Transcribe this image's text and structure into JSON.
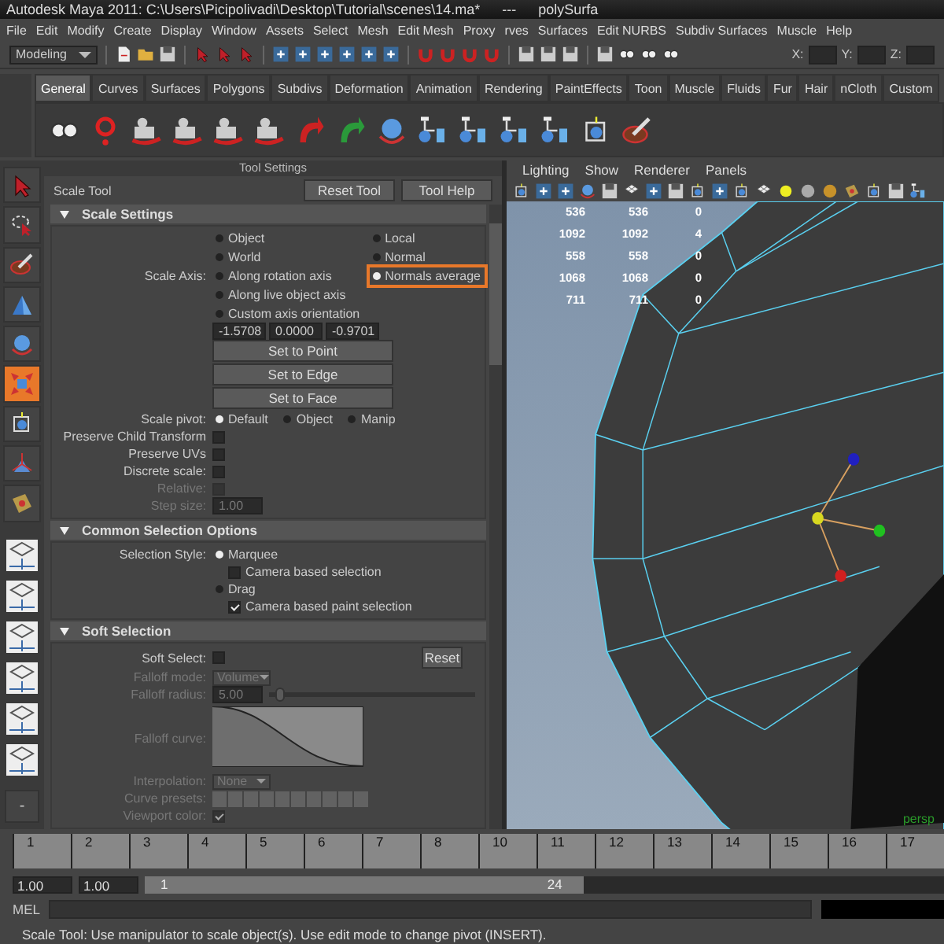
{
  "window": {
    "title": "Autodesk Maya 2011: C:\\Users\\Picipolivadi\\Desktop\\Tutorial\\scenes\\14.ma*",
    "subtitle": "---",
    "object": "polySurfa"
  },
  "menu_bar": [
    "File",
    "Edit",
    "Modify",
    "Create",
    "Display",
    "Window",
    "Assets",
    "Select",
    "Mesh",
    "Edit Mesh",
    "Proxy",
    "rves",
    "Surfaces",
    "Edit NURBS",
    "Subdiv Surfaces",
    "Muscle",
    "Help"
  ],
  "status_line": {
    "mode": "Modeling",
    "coords": [
      "X:",
      "Y:",
      "Z:"
    ]
  },
  "shelf": {
    "tabs": [
      {
        "label": "General",
        "selected": true
      },
      {
        "label": "Curves",
        "selected": false
      },
      {
        "label": "Surfaces",
        "selected": false
      },
      {
        "label": "Polygons",
        "selected": false
      },
      {
        "label": "Subdivs",
        "selected": false
      },
      {
        "label": "Deformation",
        "selected": false
      },
      {
        "label": "Animation",
        "selected": false
      },
      {
        "label": "Rendering",
        "selected": false
      },
      {
        "label": "PaintEffects",
        "selected": false
      },
      {
        "label": "Toon",
        "selected": false
      },
      {
        "label": "Muscle",
        "selected": false
      },
      {
        "label": "Fluids",
        "selected": false
      },
      {
        "label": "Fur",
        "selected": false
      },
      {
        "label": "Hair",
        "selected": false
      },
      {
        "label": "nCloth",
        "selected": false
      },
      {
        "label": "Custom",
        "selected": false
      }
    ]
  },
  "toolbox": {
    "tools": [
      {
        "selected": false
      },
      {
        "selected": false
      },
      {
        "selected": false
      },
      {
        "selected": false
      },
      {
        "selected": false
      },
      {
        "selected": true
      },
      {
        "selected": false
      },
      {
        "selected": false
      },
      {
        "selected": false
      }
    ],
    "collapse_label": "-"
  },
  "tool_settings": {
    "title": "Tool Settings",
    "tool_name": "Scale Tool",
    "buttons": [
      "Reset Tool",
      "Tool Help"
    ],
    "sections": [
      {
        "title": "Scale Settings",
        "expanded": true,
        "rows": [
          {
            "kind": "radio_columns",
            "label": "Scale Axis:",
            "columns": [
              [
                {
                  "label": "Object",
                  "selected": false,
                  "highlighted": false
                },
                {
                  "label": "World",
                  "selected": false,
                  "highlighted": false
                },
                {
                  "label": "Along rotation axis",
                  "selected": false,
                  "highlighted": false
                },
                {
                  "label": "Along live object axis",
                  "selected": false,
                  "highlighted": false
                },
                {
                  "label": "Custom axis orientation",
                  "selected": false,
                  "highlighted": false
                }
              ],
              [
                {
                  "label": "Local",
                  "selected": false,
                  "highlighted": false
                },
                {
                  "label": "Normal",
                  "selected": false,
                  "highlighted": false
                },
                {
                  "label": "Normals average",
                  "selected": true,
                  "highlighted": true
                }
              ]
            ]
          },
          {
            "kind": "fields",
            "values": [
              "-1.5708",
              "0.0000",
              "-0.9701"
            ]
          },
          {
            "kind": "button",
            "label": "Set to Point"
          },
          {
            "kind": "button",
            "label": "Set to Edge"
          },
          {
            "kind": "button",
            "label": "Set to Face"
          },
          {
            "kind": "radio_row",
            "label": "Scale pivot:",
            "options": [
              {
                "label": "Default",
                "selected": true
              },
              {
                "label": "Object",
                "selected": false
              },
              {
                "label": "Manip",
                "selected": false
              }
            ]
          },
          {
            "kind": "check",
            "label": "Preserve Child Transform",
            "checked": false,
            "disabled": false
          },
          {
            "kind": "check",
            "label": "Preserve UVs",
            "checked": false,
            "disabled": false
          },
          {
            "kind": "check",
            "label": "Discrete scale:",
            "checked": false,
            "disabled": false
          },
          {
            "kind": "check",
            "label": "Relative:",
            "checked": false,
            "disabled": true
          },
          {
            "kind": "field",
            "label": "Step size:",
            "value": "1.00",
            "disabled": true
          }
        ]
      },
      {
        "title": "Common Selection Options",
        "expanded": true,
        "rows": [
          {
            "kind": "radio",
            "label": "Selection Style:",
            "option": "Marquee",
            "selected": true
          },
          {
            "kind": "sub_check",
            "label": "Camera based selection",
            "checked": false
          },
          {
            "kind": "radio",
            "option": "Drag",
            "selected": false
          },
          {
            "kind": "sub_check",
            "label": "Camera based paint selection",
            "checked": true
          }
        ]
      },
      {
        "title": "Soft Selection",
        "expanded": true,
        "rows": [
          {
            "kind": "check",
            "label": "Soft Select:",
            "checked": false,
            "disabled": false,
            "button": "Reset"
          },
          {
            "kind": "dropdown",
            "label": "Falloff mode:",
            "value": "Volume",
            "disabled": true
          },
          {
            "kind": "slider",
            "label": "Falloff radius:",
            "value": "5.00",
            "level": 0.05,
            "disabled": true
          },
          {
            "kind": "curve",
            "label": "Falloff curve:",
            "disabled": true
          },
          {
            "kind": "dropdown",
            "label": "Interpolation:",
            "value": "None",
            "disabled": true
          },
          {
            "kind": "presets",
            "label": "Curve presets:",
            "disabled": true
          },
          {
            "kind": "check",
            "label": "Viewport color:",
            "checked": true,
            "disabled": true
          }
        ]
      }
    ]
  },
  "viewport": {
    "menu": [
      "Lighting",
      "Show",
      "Renderer",
      "Panels"
    ],
    "heads_up": [
      [
        "536",
        "536",
        "0"
      ],
      [
        "1092",
        "1092",
        "4"
      ],
      [
        "558",
        "558",
        "0"
      ],
      [
        "1068",
        "1068",
        "0"
      ],
      [
        "711",
        "711",
        "0"
      ]
    ],
    "camera": "persp"
  },
  "time_slider": {
    "ticks": [
      "1",
      "2",
      "3",
      "4",
      "5",
      "6",
      "7",
      "8",
      "10",
      "11",
      "12",
      "13",
      "14",
      "15",
      "16",
      "17"
    ]
  },
  "range_slider": {
    "start": "1.00",
    "playback_start": "1.00",
    "range_start": "1",
    "range_end": "24",
    "level": 0.55
  },
  "command_line": {
    "label": "MEL"
  },
  "help_line": "Scale Tool: Use manipulator to scale object(s). Use edit mode to change pivot (INSERT)."
}
